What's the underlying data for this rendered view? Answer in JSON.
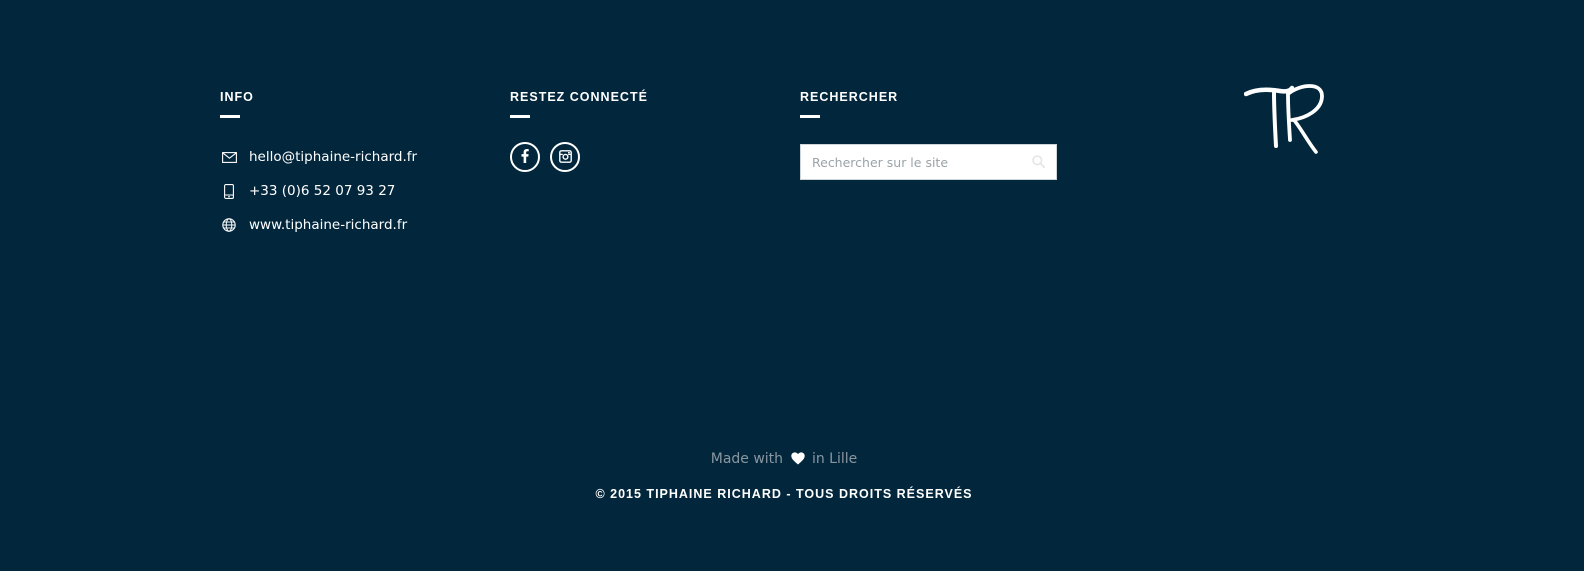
{
  "info": {
    "title": "INFO",
    "items": [
      {
        "icon": "envelope-icon",
        "text": "hello@tiphaine-richard.fr"
      },
      {
        "icon": "mobile-phone-icon",
        "text": "+33 (0)6 52 07 93 27"
      },
      {
        "icon": "globe-icon",
        "text": "www.tiphaine-richard.fr"
      }
    ]
  },
  "social": {
    "title": "RESTEZ CONNECTÉ",
    "links": [
      {
        "icon": "facebook-icon"
      },
      {
        "icon": "instagram-icon"
      }
    ]
  },
  "search": {
    "title": "RECHERCHER",
    "placeholder": "Rechercher sur le site",
    "icon": "search-icon"
  },
  "logo": {
    "icon": "tr-monogram-logo",
    "text": "TR"
  },
  "footer": {
    "made_with_prefix": "Made with",
    "made_with_icon": "heart-icon",
    "made_with_suffix": "in Lille",
    "copyright": "© 2015 TIPHAINE RICHARD - TOUS DROITS RÉSERVÉS"
  },
  "colors": {
    "background": "#02263b",
    "text": "#ffffff",
    "muted_text": "#8a96a0"
  }
}
